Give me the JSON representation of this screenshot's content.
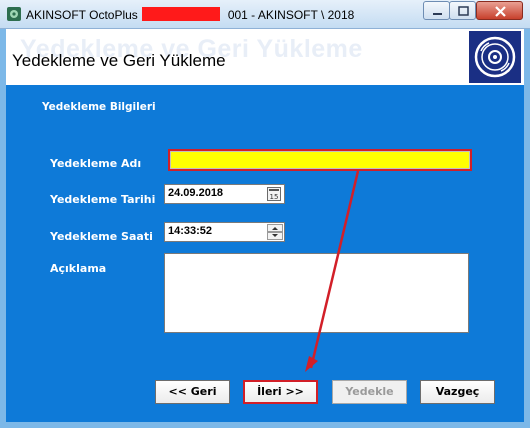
{
  "window": {
    "title_prefix": "AKINSOFT OctoPlus",
    "title_suffix": "001 - AKINSOFT \\ 2018",
    "controls": [
      "minimize-icon",
      "maximize-icon",
      "close-icon"
    ]
  },
  "header": {
    "watermark": "Yedekleme ve Geri Yükleme",
    "title": "Yedekleme ve Geri Yükleme",
    "logo_icon": "disc-icon"
  },
  "form": {
    "section_title": "Yedekleme Bilgileri",
    "name_label": "Yedekleme Adı",
    "name_value": "",
    "date_label": "Yedekleme Tarihi",
    "date_value": "24.09.2018",
    "time_label": "Yedekleme Saati",
    "time_value": "14:33:52",
    "description_label": "Açıklama",
    "description_value": ""
  },
  "buttons": {
    "back": "<< Geri",
    "next": "İleri >>",
    "backup": "Yedekle",
    "cancel": "Vazgeç"
  },
  "colors": {
    "content_bg": "#0e7ad8",
    "highlight": "#d21f28",
    "name_field_bg": "#ffff00",
    "logo_bg": "#1a2f84"
  }
}
